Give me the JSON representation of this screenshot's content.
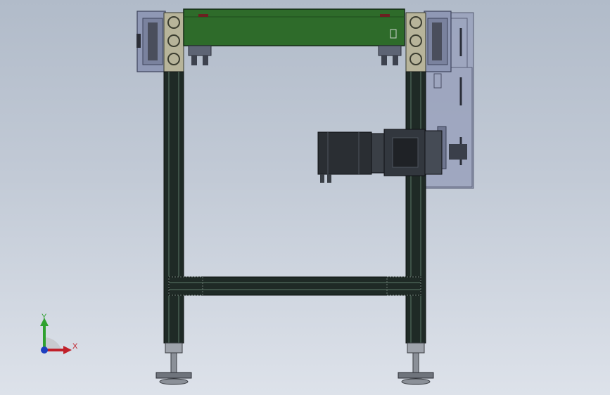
{
  "viewport": {
    "background_top": "#b1bbc9",
    "background_bottom": "#dde2ea"
  },
  "colors": {
    "conveyor_belt": "#2e6b2a",
    "frame_profile": "#1f2a26",
    "housing": "#8f98b5",
    "motor_body": "#2a2e33",
    "axis_x": "#c0202a",
    "axis_y": "#2fa12f",
    "axis_z": "#1d3fc0"
  },
  "model": {
    "name": "belt-conveyor-assembly",
    "components": [
      "conveyor-belt",
      "left-drive-housing",
      "right-drive-housing",
      "left-leg",
      "right-leg",
      "cross-beam",
      "gear-motor",
      "chain-guard",
      "left-foot",
      "right-foot"
    ]
  },
  "triad": {
    "x_label": "X",
    "y_label": "Y"
  }
}
